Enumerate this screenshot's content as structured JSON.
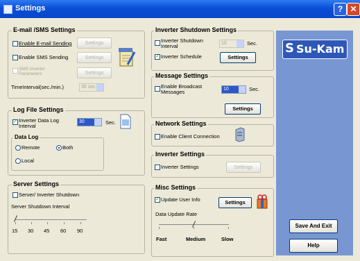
{
  "window": {
    "title": "Settings"
  },
  "email_sms": {
    "title": "E-mail /SMS  Settings",
    "enable_email": {
      "label": "Enable E-mail Sending",
      "checked": false
    },
    "enable_sms": {
      "label": "Enable SMS Sending",
      "checked": false
    },
    "sms_inverter": {
      "label_1": "SMS Inverter",
      "label_2": "Parameters",
      "checked": false
    },
    "settings_label": "Settings",
    "time_interval_label": "TimeInterval(sec./min.)",
    "time_interval_value": "30 sec."
  },
  "log_file": {
    "title": "Log File Settings",
    "inverter_data_log": {
      "label_1": "Inverter Data Log",
      "label_2": "Interval",
      "checked": true
    },
    "interval_value": "30",
    "sec_label": "Sec.",
    "data_log": {
      "title": "Data Log",
      "options": [
        "Remote",
        "Both",
        "Local"
      ],
      "selected": "Both"
    }
  },
  "server": {
    "title": "Server Settings",
    "shutdown": {
      "label": "Server/ Inverter Shutdown",
      "checked": false
    },
    "interval_label": "Server Shutdown Interval",
    "ticks": [
      "15",
      "30",
      "45",
      "60",
      "90"
    ],
    "selected_value": "15"
  },
  "inverter_shutdown": {
    "title": "Inverter Shutdown Settings",
    "shutdown_interval": {
      "label_1": "Inverter  Shutdown",
      "label_2": "Interval",
      "checked": false
    },
    "interval_value": "10",
    "sec_label": "Sec.",
    "schedule": {
      "label": "Inverter Schedule",
      "checked": true
    },
    "settings_label": "Settings"
  },
  "message": {
    "title": "Message Settings",
    "broadcast": {
      "label_1": "Enable Broadcast",
      "label_2": "Messages",
      "checked": false
    },
    "interval_value": "10",
    "sec_label": "Sec.",
    "settings_label": "Settings"
  },
  "network": {
    "title": "Network Settings",
    "client_connection": {
      "label": "Enable Client Connection",
      "checked": false
    }
  },
  "inverter": {
    "title": "Inverter Settings",
    "inverter_settings": {
      "label": "Inverter Settings",
      "checked": false
    },
    "settings_label": "Settings"
  },
  "misc": {
    "title": "Misc Settings",
    "update_user_info": {
      "label": "Update User Info",
      "checked": true
    },
    "settings_label": "Settings",
    "rate_label": "Data Update Rate",
    "rate_options": [
      "Fast",
      "Medium",
      "Slow"
    ],
    "rate_selected": "Medium"
  },
  "sidebar": {
    "logo_mark": "S",
    "logo_text": "Su-Kam",
    "save_exit_label": "Save And Exit",
    "help_label": "Help"
  },
  "colors": {
    "titlebar": "#0A4FD8",
    "sidebar": "#7896D2",
    "background": "#ECE9D8"
  }
}
